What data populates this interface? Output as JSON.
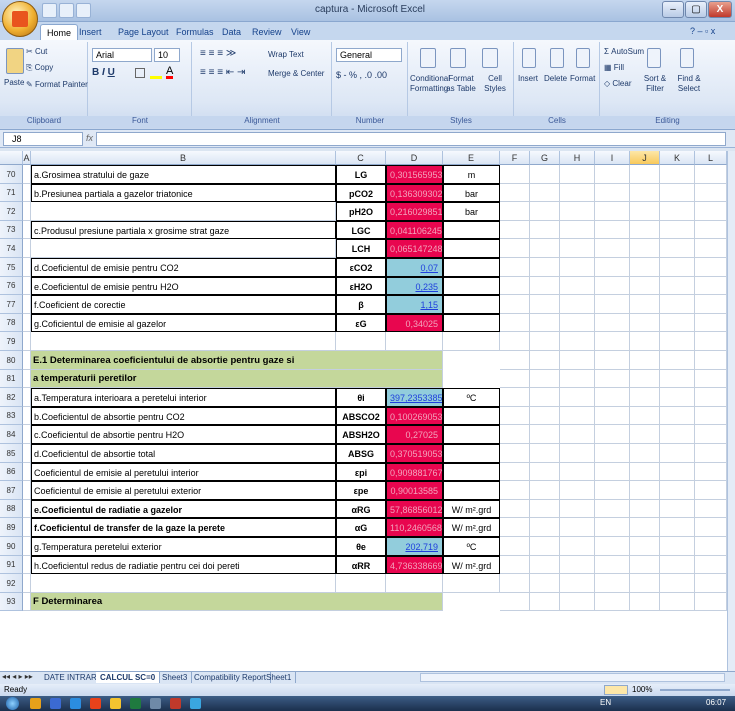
{
  "window": {
    "title": "captura - Microsoft Excel",
    "min": "–",
    "max": "▢",
    "close": "X"
  },
  "tabs": [
    "Home",
    "Insert",
    "Page Layout",
    "Formulas",
    "Data",
    "Review",
    "View"
  ],
  "ribbon": {
    "clipboard": {
      "paste": "Paste",
      "cut": "Cut",
      "copy": "Copy",
      "format_painter": "Format Painter",
      "label": "Clipboard"
    },
    "font": {
      "name": "Arial",
      "size": "10",
      "label": "Font"
    },
    "alignment": {
      "wrap": "Wrap Text",
      "merge": "Merge & Center",
      "label": "Alignment"
    },
    "number": {
      "format": "General",
      "label": "Number"
    },
    "styles": {
      "conditional": "Conditional Formatting",
      "table": "Format as Table",
      "cell": "Cell Styles",
      "label": "Styles"
    },
    "cells": {
      "insert": "Insert",
      "delete": "Delete",
      "format": "Format",
      "label": "Cells"
    },
    "editing": {
      "autosum": "AutoSum",
      "fill": "Fill",
      "clear": "Clear",
      "sort": "Sort & Filter",
      "find": "Find & Select",
      "label": "Editing"
    }
  },
  "formula_bar": {
    "name_box": "J8",
    "fx": "fx",
    "content": ""
  },
  "columns": [
    "A",
    "B",
    "C",
    "D",
    "E",
    "F",
    "G",
    "H",
    "I",
    "J",
    "K",
    "L"
  ],
  "rows": [
    {
      "n": "70",
      "label": "a.Grosimea stratului de gaze",
      "sym": "LG",
      "val": "0,301565953",
      "unit": "m",
      "style": "pink"
    },
    {
      "n": "71",
      "label": "b.Presiunea partiala a gazelor triatonice",
      "sym": "pCO2",
      "val": "0,136309302",
      "unit": "bar",
      "style": "pink"
    },
    {
      "n": "72",
      "label": "",
      "sym": "pH2O",
      "val": "0,216029851",
      "unit": "bar",
      "style": "pink"
    },
    {
      "n": "73",
      "label": "c.Produsul presiune partiala x grosime strat gaze",
      "sym": "LGC",
      "val": "0,041106245",
      "unit": "",
      "style": "pink"
    },
    {
      "n": "74",
      "label": "",
      "sym": "LCH",
      "val": "0,065147248",
      "unit": "",
      "style": "pink"
    },
    {
      "n": "75",
      "label": "d.Coeficientul de emisie pentru CO2",
      "sym": "εCO2",
      "val": "0,07",
      "unit": "",
      "style": "blue"
    },
    {
      "n": "76",
      "label": "e.Coeficientul de emisie pentru H2O",
      "sym": "εH2O",
      "val": "0,235",
      "unit": "",
      "style": "blue"
    },
    {
      "n": "77",
      "label": "f.Coeficient de corectie",
      "sym": "β",
      "val": "1,15",
      "unit": "",
      "style": "blue"
    },
    {
      "n": "78",
      "label": "g.Coficientul de emisie al gazelor",
      "sym": "εG",
      "val": "0,34025",
      "unit": "",
      "style": "pink"
    },
    {
      "n": "79",
      "label": "",
      "sym": "",
      "val": "",
      "unit": "",
      "style": ""
    },
    {
      "n": "80",
      "label": "E.1 Determinarea coeficientului de absortie pentru gaze si",
      "sym": "",
      "val": "",
      "unit": "",
      "style": "green"
    },
    {
      "n": "81",
      "label": "a temperaturii peretilor",
      "sym": "",
      "val": "",
      "unit": "",
      "style": "green"
    },
    {
      "n": "82",
      "label": "a.Temperatura interioara a peretelui interior",
      "sym": "θi",
      "val": "397,2353385",
      "unit": "ºC",
      "style": "blue"
    },
    {
      "n": "83",
      "label": "b.Coeficientul de absortie pentru CO2",
      "sym": "ABSCO2",
      "val": "0,100269053",
      "unit": "",
      "style": "pink"
    },
    {
      "n": "84",
      "label": "c.Coeficientul de absortie pentru H2O",
      "sym": "ABSH2O",
      "val": "0,27025",
      "unit": "",
      "style": "pink"
    },
    {
      "n": "85",
      "label": "d.Coeficientul de absortie total",
      "sym": "ABSG",
      "val": "0,370519053",
      "unit": "",
      "style": "pink"
    },
    {
      "n": "86",
      "label": "Coeficientul de emisie al peretului interior",
      "sym": "εpi",
      "val": "0,909881767",
      "unit": "",
      "style": "pink"
    },
    {
      "n": "87",
      "label": " Coeficientul de emisie al peretului exterior",
      "sym": "εpe",
      "val": "0,90013585",
      "unit": "",
      "style": "pink"
    },
    {
      "n": "88",
      "label": "e.Coeficientul de radiatie a gazelor",
      "sym": "αRG",
      "val": "57,86856012",
      "unit": "W/ m².grd",
      "style": "pink"
    },
    {
      "n": "89",
      "label": "f.Coeficientul de transfer de la gaze la perete",
      "sym": "αG",
      "val": "110,2460568",
      "unit": "W/ m².grd",
      "style": "pink"
    },
    {
      "n": "90",
      "label": "g.Temperatura peretelui exterior",
      "sym": "θe",
      "val": "202,719",
      "unit": "ºC",
      "style": "blue"
    },
    {
      "n": "91",
      "label": "h.Coeficientul redus de radiatie pentru cei doi pereti",
      "sym": "αRR",
      "val": "4,736338669",
      "unit": "W/ m².grd",
      "style": "pink"
    },
    {
      "n": "92",
      "label": "",
      "sym": "",
      "val": "",
      "unit": "",
      "style": ""
    },
    {
      "n": "93",
      "label": "F Determinarea",
      "sym": "",
      "val": "",
      "unit": "",
      "style": "green"
    }
  ],
  "sheets": [
    "DATE INTRARE",
    "CALCUL SC=0",
    "Sheet3",
    "Compatibility Report",
    "Sheet1"
  ],
  "status": {
    "ready": "Ready",
    "zoom": "100%"
  },
  "taskbar": {
    "lang": "EN",
    "time": "06:07"
  }
}
